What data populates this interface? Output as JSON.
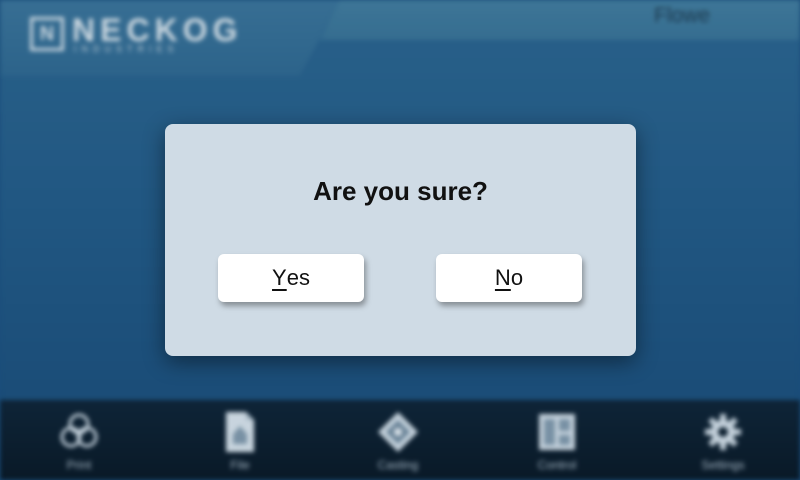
{
  "header": {
    "brand_mark": "N",
    "brand_name": "NECKOG",
    "brand_sub": "INDUSTRIES",
    "user_text": "Flowe"
  },
  "dialog": {
    "title": "Are you sure?",
    "yes_first": "Y",
    "yes_rest": "es",
    "no_first": "N",
    "no_rest": "o"
  },
  "nav": {
    "items": [
      {
        "label": "Print",
        "icon": "print-icon"
      },
      {
        "label": "File",
        "icon": "file-icon"
      },
      {
        "label": "Casting",
        "icon": "casting-icon"
      },
      {
        "label": "Control",
        "icon": "control-icon"
      },
      {
        "label": "Settings",
        "icon": "gear-icon"
      }
    ]
  },
  "colors": {
    "background": "#225a86",
    "dialog": "#cfdbe5",
    "nav": "#0d2030"
  }
}
